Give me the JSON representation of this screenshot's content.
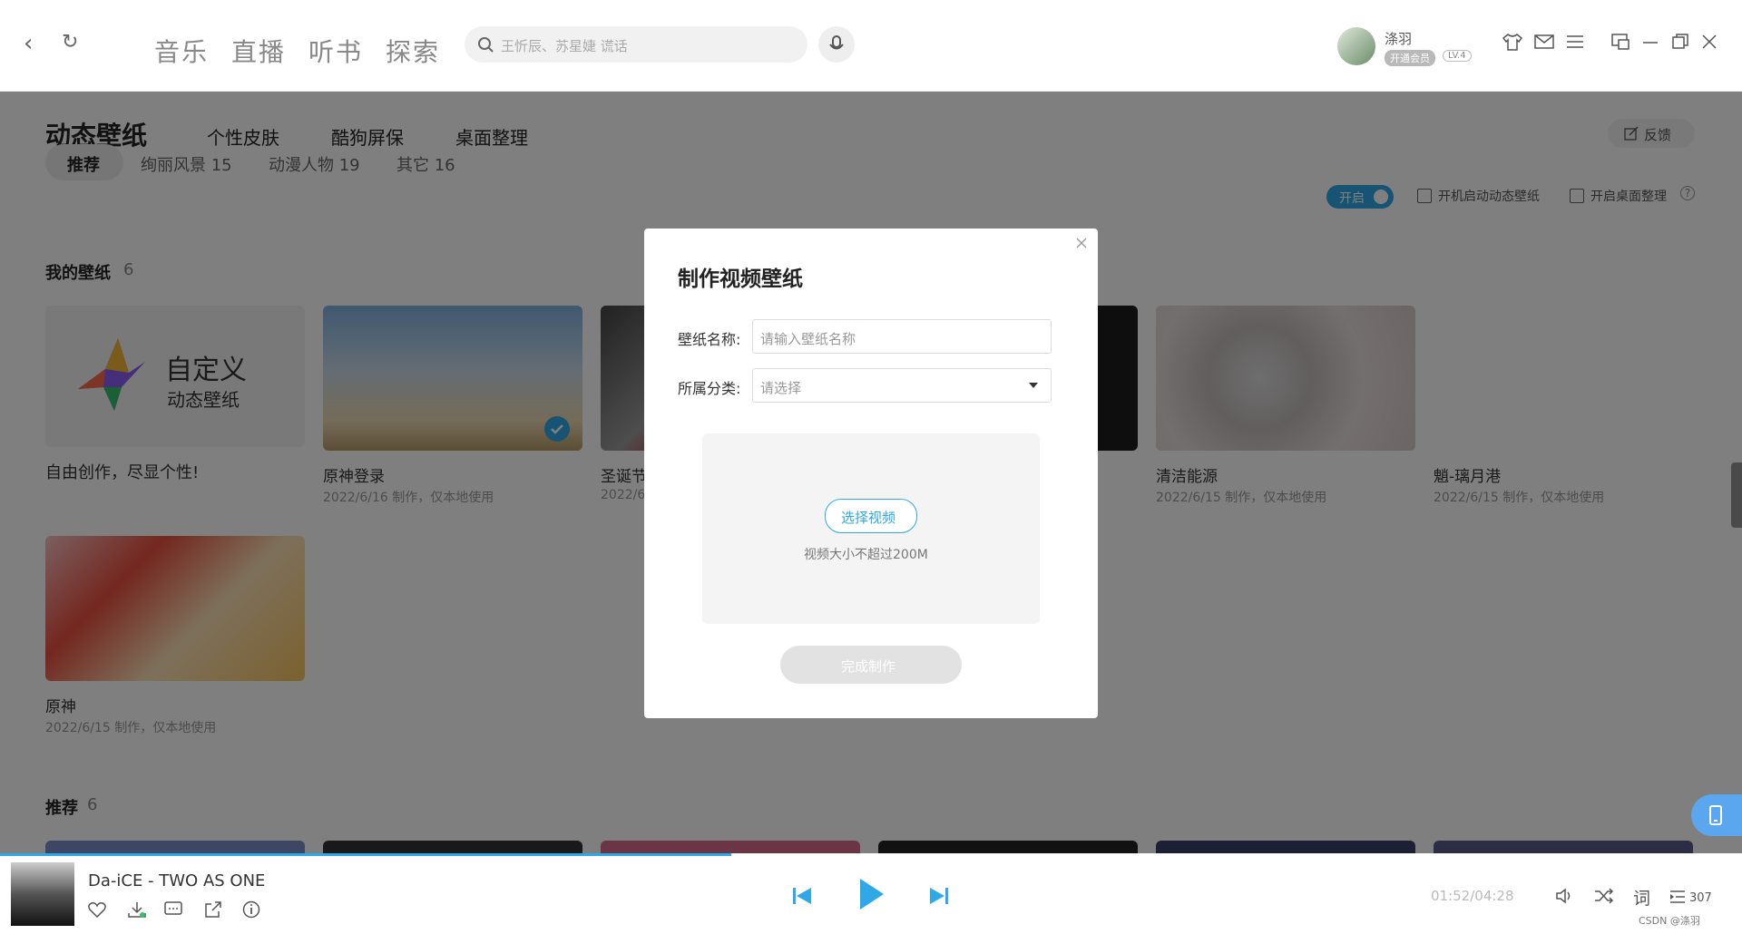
{
  "nav": {
    "back_icon": "‹",
    "refresh_icon": "↻"
  },
  "tabs": [
    "音乐",
    "直播",
    "听书",
    "探索"
  ],
  "search": {
    "placeholder": "王忻辰、苏星婕 谎话"
  },
  "user": {
    "name": "涤羽",
    "vip_badge": "开通会员",
    "level": "LV.4"
  },
  "header_tabs": [
    "动态壁纸",
    "个性皮肤",
    "酷狗屏保",
    "桌面整理"
  ],
  "feedback": "反馈",
  "filters": [
    "推荐",
    "绚丽风景 15",
    "动漫人物 19",
    "其它 16"
  ],
  "toggle_label": "开启",
  "checkbox_boot": "开机启动动态壁纸",
  "checkbox_desktop": "开启桌面整理",
  "my_section": {
    "title": "我的壁纸",
    "count": "6"
  },
  "custom_card": {
    "line1": "自定义",
    "line2": "动态壁纸",
    "caption": "自由创作，尽显个性!"
  },
  "cards": [
    {
      "title": "原神登录",
      "sub": "2022/6/16 制作，仅本地使用"
    },
    {
      "title": "圣诞节",
      "sub": "2022/6"
    },
    {
      "title": "清洁能源",
      "sub": "2022/6/15 制作，仅本地使用"
    },
    {
      "title": "魈-璃月港",
      "sub": "2022/6/15 制作，仅本地使用"
    },
    {
      "title": "原神",
      "sub": "2022/6/15 制作，仅本地使用"
    }
  ],
  "rec_section": {
    "title": "推荐",
    "count": "6"
  },
  "dialog": {
    "title": "制作视频壁纸",
    "name_label": "壁纸名称:",
    "name_placeholder": "请输入壁纸名称",
    "cat_label": "所属分类:",
    "cat_placeholder": "请选择",
    "select_btn": "选择视频",
    "hint": "视频大小不超过200M",
    "submit": "完成制作"
  },
  "player": {
    "song": "Da-iCE - TWO AS ONE",
    "time": "01:52/04:28",
    "lyrics_btn": "词",
    "playlist_count": "307",
    "watermark": "CSDN @涤羽",
    "progress": 0.42
  }
}
